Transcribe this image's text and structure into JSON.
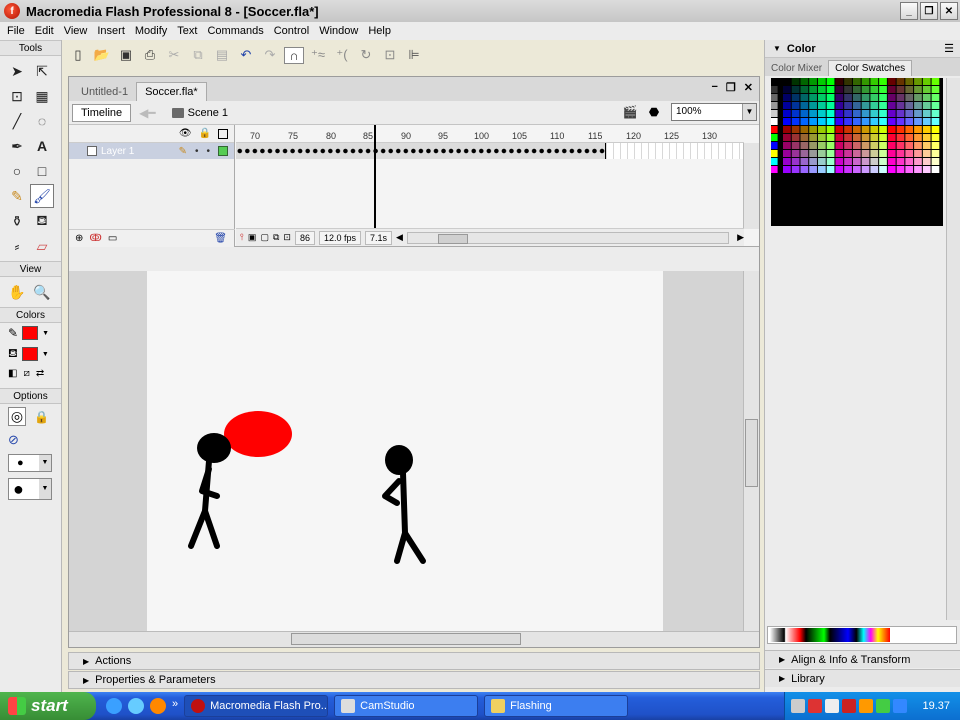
{
  "window": {
    "title": "Macromedia Flash Professional 8 - [Soccer.fla*]",
    "icon": "flash-app-icon",
    "buttons": [
      "_",
      "❐",
      "✕"
    ]
  },
  "menu": [
    "File",
    "Edit",
    "View",
    "Insert",
    "Modify",
    "Text",
    "Commands",
    "Control",
    "Window",
    "Help"
  ],
  "tools": {
    "header": "Tools",
    "view_header": "View",
    "colors_header": "Colors",
    "options_header": "Options",
    "stroke_color": "#ff0000",
    "fill_color": "#ff0000"
  },
  "document": {
    "tabs": [
      "Untitled-1",
      "Soccer.fla*"
    ],
    "active_tab": 1,
    "timeline_label": "Timeline",
    "scene": "Scene 1",
    "zoom": "100%"
  },
  "timeline": {
    "layer_name": "Layer 1",
    "ruler": [
      "70",
      "75",
      "80",
      "85",
      "90",
      "95",
      "100",
      "105",
      "110",
      "115",
      "120",
      "125",
      "130"
    ],
    "current_frame": "86",
    "fps": "12.0 fps",
    "elapsed": "7.1s"
  },
  "stage": {
    "ball_color": "#ff0000",
    "figure_color": "#000000",
    "background": "#f6f6f6"
  },
  "lower_panels": [
    "Actions",
    "Properties & Parameters"
  ],
  "right_panel": {
    "title": "Color",
    "tabs": [
      "Color Mixer",
      "Color Swatches"
    ],
    "active_tab": 1,
    "lower": [
      "Align & Info & Transform",
      "Library"
    ]
  },
  "taskbar": {
    "start": "start",
    "tasks": [
      "Macromedia Flash Pro...",
      "CamStudio",
      "Flashing"
    ],
    "active_task": 0,
    "clock": "19.37"
  }
}
